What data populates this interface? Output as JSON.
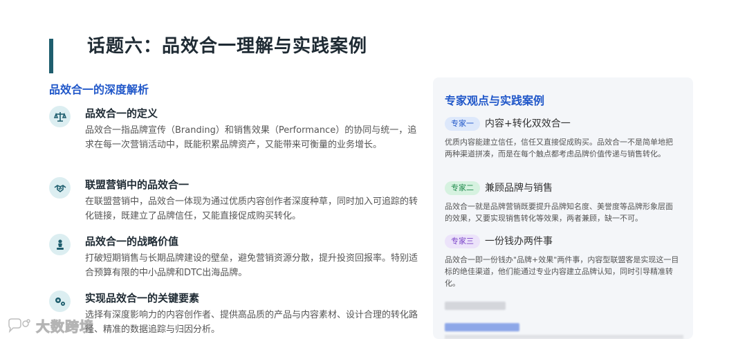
{
  "header": {
    "title": "话题六：品效合一理解与实践案例"
  },
  "left": {
    "section_title": "品效合一的深度解析",
    "items": [
      {
        "icon": "scale-icon",
        "title": "品效合一的定义",
        "desc": "品效合一指品牌宣传（Branding）和销售效果（Performance）的协同与统一，追求在每一次营销活动中，既能积累品牌资产，又能带来可衡量的业务增长。"
      },
      {
        "icon": "handshake-icon",
        "title": "联盟营销中的品效合一",
        "desc": "在联盟营销中，品效合一体现为通过优质内容创作者深度种草，同时加入可追踪的转化链接，既建立了品牌信任，又能直接促成购买转化。"
      },
      {
        "icon": "chess-piece-icon",
        "title": "品效合一的战略价值",
        "desc": "打破短期销售与长期品牌建设的壁垒，避免营销资源分散，提升投资回报率。特别适合预算有限的中小品牌和DTC出海品牌。"
      },
      {
        "icon": "gears-icon",
        "title": "实现品效合一的关键要素",
        "desc": "选择有深度影响力的内容创作者、提供高品质的产品与内容素材、设计合理的转化路径、精准的数据追踪与归因分析。"
      }
    ]
  },
  "right": {
    "title": "专家观点与实践案例",
    "experts": [
      {
        "tag": "专家一",
        "head": "内容+转化双效合一",
        "text": "优质内容能建立信任，信任又直接促成购买。品效合一不是简单地把两种渠道拼凑，而是在每个触点都考虑品牌价值传递与销售转化。"
      },
      {
        "tag": "专家二",
        "head": "兼顾品牌与销售",
        "text": "品效合一就是品牌营销既要提升品牌知名度、美誉度等品牌形象层面的效果，又要实现销售转化等效果，两者兼顾，缺一不可。"
      },
      {
        "tag": "专家三",
        "head": "一份钱办两件事",
        "text": "品效合一即一份钱办\"品牌+效果\"两件事，内容型联盟客是实现这一目标的绝佳渠道，他们能通过专业内容建立品牌认知，同时引导精准转化。"
      }
    ]
  },
  "watermark": {
    "text": "大数跨境"
  },
  "colors": {
    "accent": "#1f5e6e",
    "heading_blue": "#2057c9"
  }
}
